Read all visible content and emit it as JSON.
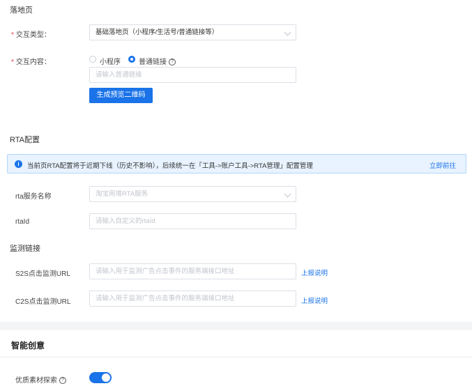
{
  "landing": {
    "title": "落地页",
    "interaction_type": {
      "required_mark": "*",
      "label": "交互类型：",
      "value": "基础落地页（小程序/生活号/普通链接等）"
    },
    "interaction_content": {
      "required_mark": "*",
      "label": "交互内容：",
      "options": [
        "小程序",
        "普通链接"
      ],
      "selected": "普通链接",
      "help": "?",
      "link_placeholder": "请输入普通链接",
      "generate_button": "生成预览二维码"
    }
  },
  "rta": {
    "title": "RTA配置",
    "notice": {
      "icon": "i",
      "text": "当前页RTA配置将于近期下线（历史不影响），后续统一在「工具->账户工具->RTA管理」配置管理",
      "link": "立即前往"
    },
    "service_name": {
      "label": "rta服务名称",
      "placeholder": "淘宝用增RTA服务"
    },
    "rta_id": {
      "label": "rtaId",
      "placeholder": "请输入自定义的rtaId"
    }
  },
  "monitor": {
    "title": "监测链接",
    "s2s": {
      "label": "S2S点击监测URL",
      "placeholder": "请输入用于监测广告点击事件的服务端接口地址",
      "link": "上报说明"
    },
    "c2s": {
      "label": "C2S点击监测URL",
      "placeholder": "请输入用于监测广告点击事件的服务端接口地址",
      "link": "上报说明"
    }
  },
  "smart": {
    "title": "智能创意",
    "quality_explore": {
      "label": "优质素材探索",
      "help": "?",
      "enabled": true
    }
  }
}
